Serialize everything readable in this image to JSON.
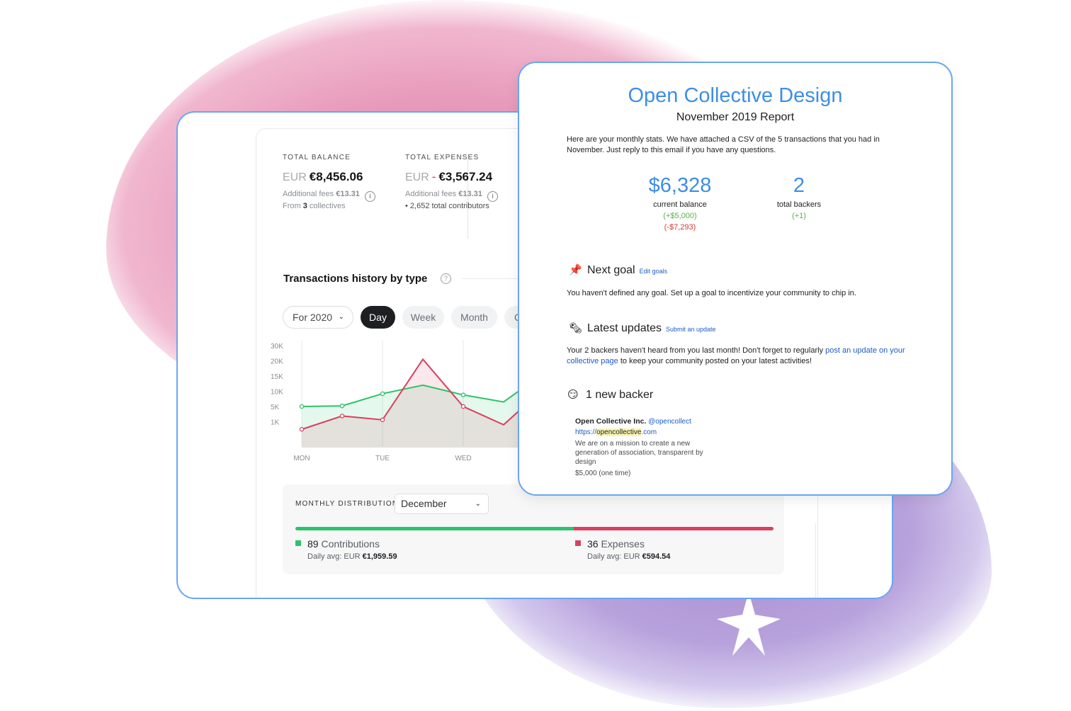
{
  "colors": {
    "accent_blue": "#3d8ee6",
    "card_border": "#6aa6f0",
    "green": "#2dc36a",
    "red": "#d94060",
    "watercolor_pink": "#e79abb",
    "watercolor_purple": "#b8a2dc"
  },
  "dashboard": {
    "total_balance": {
      "label": "TOTAL BALANCE",
      "currency": "EUR",
      "amount": "€8,456.06",
      "fees_text": "Additional fees",
      "fees_amount": "€13.31",
      "source_prefix": "From",
      "source_count": "3",
      "source_suffix": "collectives"
    },
    "total_expenses": {
      "label": "TOTAL EXPENSES",
      "currency": "EUR",
      "sign": "-",
      "amount": "€3,567.24",
      "fees_text": "Additional fees",
      "fees_amount": "€13.31",
      "contributors_text": "• 2,652 total contributors"
    },
    "history": {
      "title": "Transactions history by type",
      "period_select": "For 2020",
      "pills": [
        "Day",
        "Week",
        "Month",
        "Q"
      ],
      "active_pill": "Day"
    },
    "distribution": {
      "label": "MONTHLY DISTRIBUTION",
      "month": "December",
      "contributions_count": "89",
      "contributions_label": "Contributions",
      "contributions_avg_label": "Daily avg: EUR",
      "contributions_avg": "€1,959.59",
      "expenses_count": "36",
      "expenses_label": "Expenses",
      "expenses_avg_label": "Daily avg: EUR",
      "expenses_avg": "€594.54",
      "contributions_share": 0.5825
    }
  },
  "chart_data": {
    "type": "line",
    "x": [
      "MON",
      "",
      "TUE",
      "",
      "WED",
      "",
      ""
    ],
    "x_tick_labels": [
      "MON",
      "TUE",
      "WED"
    ],
    "y_tick_labels": [
      "30K",
      "20K",
      "15K",
      "10K",
      "5K",
      "1K"
    ],
    "series": [
      {
        "name": "",
        "color": "#2dc36a",
        "values": [
          5.0,
          5.2,
          9.2,
          12.0,
          8.8,
          6.5,
          16.0
        ]
      },
      {
        "name": "",
        "color": "#d94060",
        "values": [
          0.5,
          2.5,
          1.5,
          21.0,
          5.0,
          0.8,
          11.0
        ]
      }
    ]
  },
  "email": {
    "title": "Open Collective Design",
    "subtitle": "November 2019 Report",
    "intro": "Here are your monthly stats. We have attached a CSV of the 5 transactions that you had in November. Just reply to this email if you have any questions.",
    "balance": {
      "value": "$6,328",
      "label": "current balance",
      "plus": "(+$5,000)",
      "minus": "(-$7,293)"
    },
    "backers": {
      "value": "2",
      "label": "total backers",
      "plus": "(+1)"
    },
    "next_goal": {
      "emoji": "📌",
      "title": "Next goal",
      "link": "Edit goals",
      "text": "You haven't defined any goal. Set up a goal to incentivize your community to chip in."
    },
    "latest_updates": {
      "emoji": "🗞",
      "title": "Latest updates",
      "link": "Submit an update",
      "text_before": "Your 2 backers haven't heard from you last month! Don't forget to regularly ",
      "text_link": "post an update on your collective page",
      "text_after": " to keep your community posted on your latest activities!"
    },
    "new_backer": {
      "emoji": "😏",
      "title": "1 new backer",
      "name": "Open Collective Inc.",
      "handle": "@opencollect",
      "url_prefix": "https://",
      "url_highlight": "opencollective",
      "url_suffix": ".com",
      "description": "We are on a mission to create a new generation of association, transparent by design",
      "amount": "$5,000 (one time)"
    }
  }
}
